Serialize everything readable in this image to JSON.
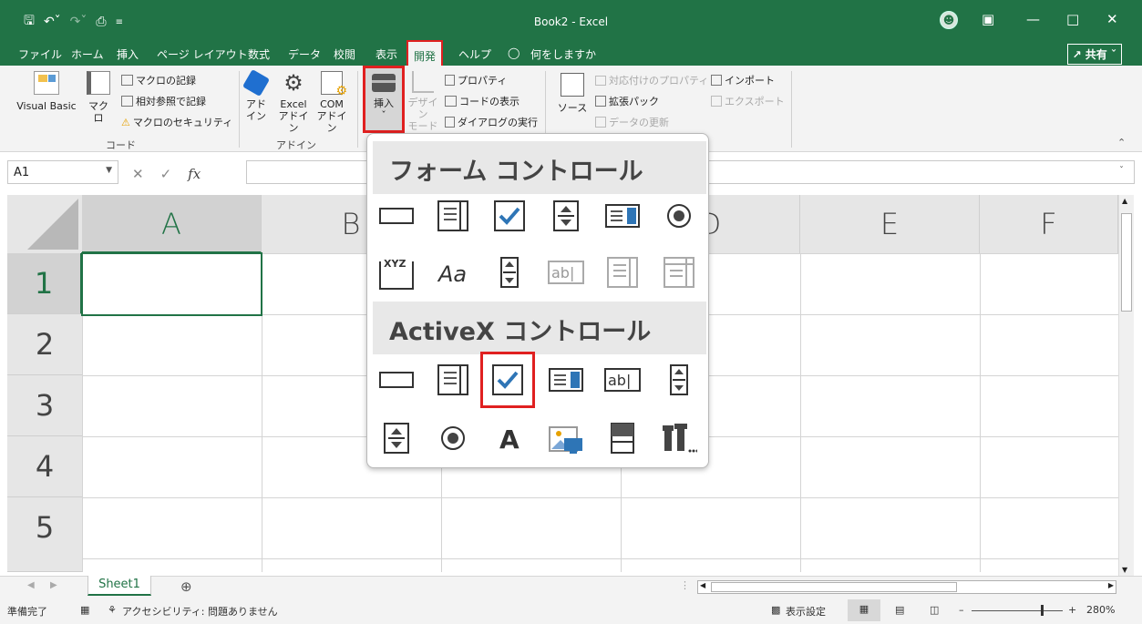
{
  "window": {
    "title": "Book2  -  Excel",
    "share_label": "共有"
  },
  "menu_tabs": [
    {
      "label": "ファイル"
    },
    {
      "label": "ホーム"
    },
    {
      "label": "挿入"
    },
    {
      "label": "ページ レイアウト"
    },
    {
      "label": "数式"
    },
    {
      "label": "データ"
    },
    {
      "label": "校閲"
    },
    {
      "label": "表示"
    },
    {
      "label": "開発"
    },
    {
      "label": "ヘルプ"
    },
    {
      "label": "何をしますか"
    }
  ],
  "ribbon": {
    "code_group": {
      "label": "コード",
      "visual_basic": "Visual Basic",
      "macro": "マクロ",
      "record_macro": "マクロの記録",
      "relative_ref": "相対参照で記録",
      "macro_security": "マクロのセキュリティ"
    },
    "addin_group": {
      "label": "アドイン",
      "addin_line1": "アド",
      "addin_line2": "イン",
      "excel_line1": "Excel",
      "excel_line2": "アドイン",
      "com_line1": "COM",
      "com_line2": "アドイン"
    },
    "controls_group": {
      "insert": "挿入",
      "design_line1": "デザイン",
      "design_line2": "モード",
      "properties": "プロパティ",
      "view_code": "コードの表示",
      "run_dialog": "ダイアログの実行"
    },
    "xml_group": {
      "source": "ソース",
      "map_properties": "対応付けのプロパティ",
      "expansion_packs": "拡張パック",
      "refresh_data": "データの更新",
      "import": "インポート",
      "export": "エクスポート"
    }
  },
  "formula_bar": {
    "name_box": "A1",
    "fx": "fx",
    "formula": ""
  },
  "grid": {
    "columns": [
      "A",
      "B",
      "C",
      "D",
      "E",
      "F"
    ],
    "rows": [
      "1",
      "2",
      "3",
      "4",
      "5"
    ],
    "active_cell": "A1"
  },
  "insert_panel": {
    "form_controls_title": "フォーム コントロール",
    "activex_controls_title": "ActiveX コントロール",
    "form_controls": [
      "button",
      "combo-box",
      "check-box",
      "spin-button",
      "list-box",
      "option-button",
      "group-box",
      "label",
      "scroll-bar",
      "text-field",
      "combo-list-edit",
      "combo-drop-down-edit"
    ],
    "activex_controls": [
      "command-button",
      "combo-box",
      "check-box",
      "list-box",
      "text-box",
      "scroll-bar",
      "spin-button",
      "option-button",
      "label",
      "image",
      "toggle-button",
      "more-controls"
    ],
    "highlighted": "activex-check-box"
  },
  "sheets": [
    {
      "label": "Sheet1"
    }
  ],
  "status_bar": {
    "ready": "準備完了",
    "accessibility": "アクセシビリティ: 問題ありません",
    "display_settings": "表示設定",
    "zoom": "280%"
  },
  "colors": {
    "excel_green": "#217346",
    "highlight_red": "#e02020",
    "check_blue": "#2e75b6"
  }
}
